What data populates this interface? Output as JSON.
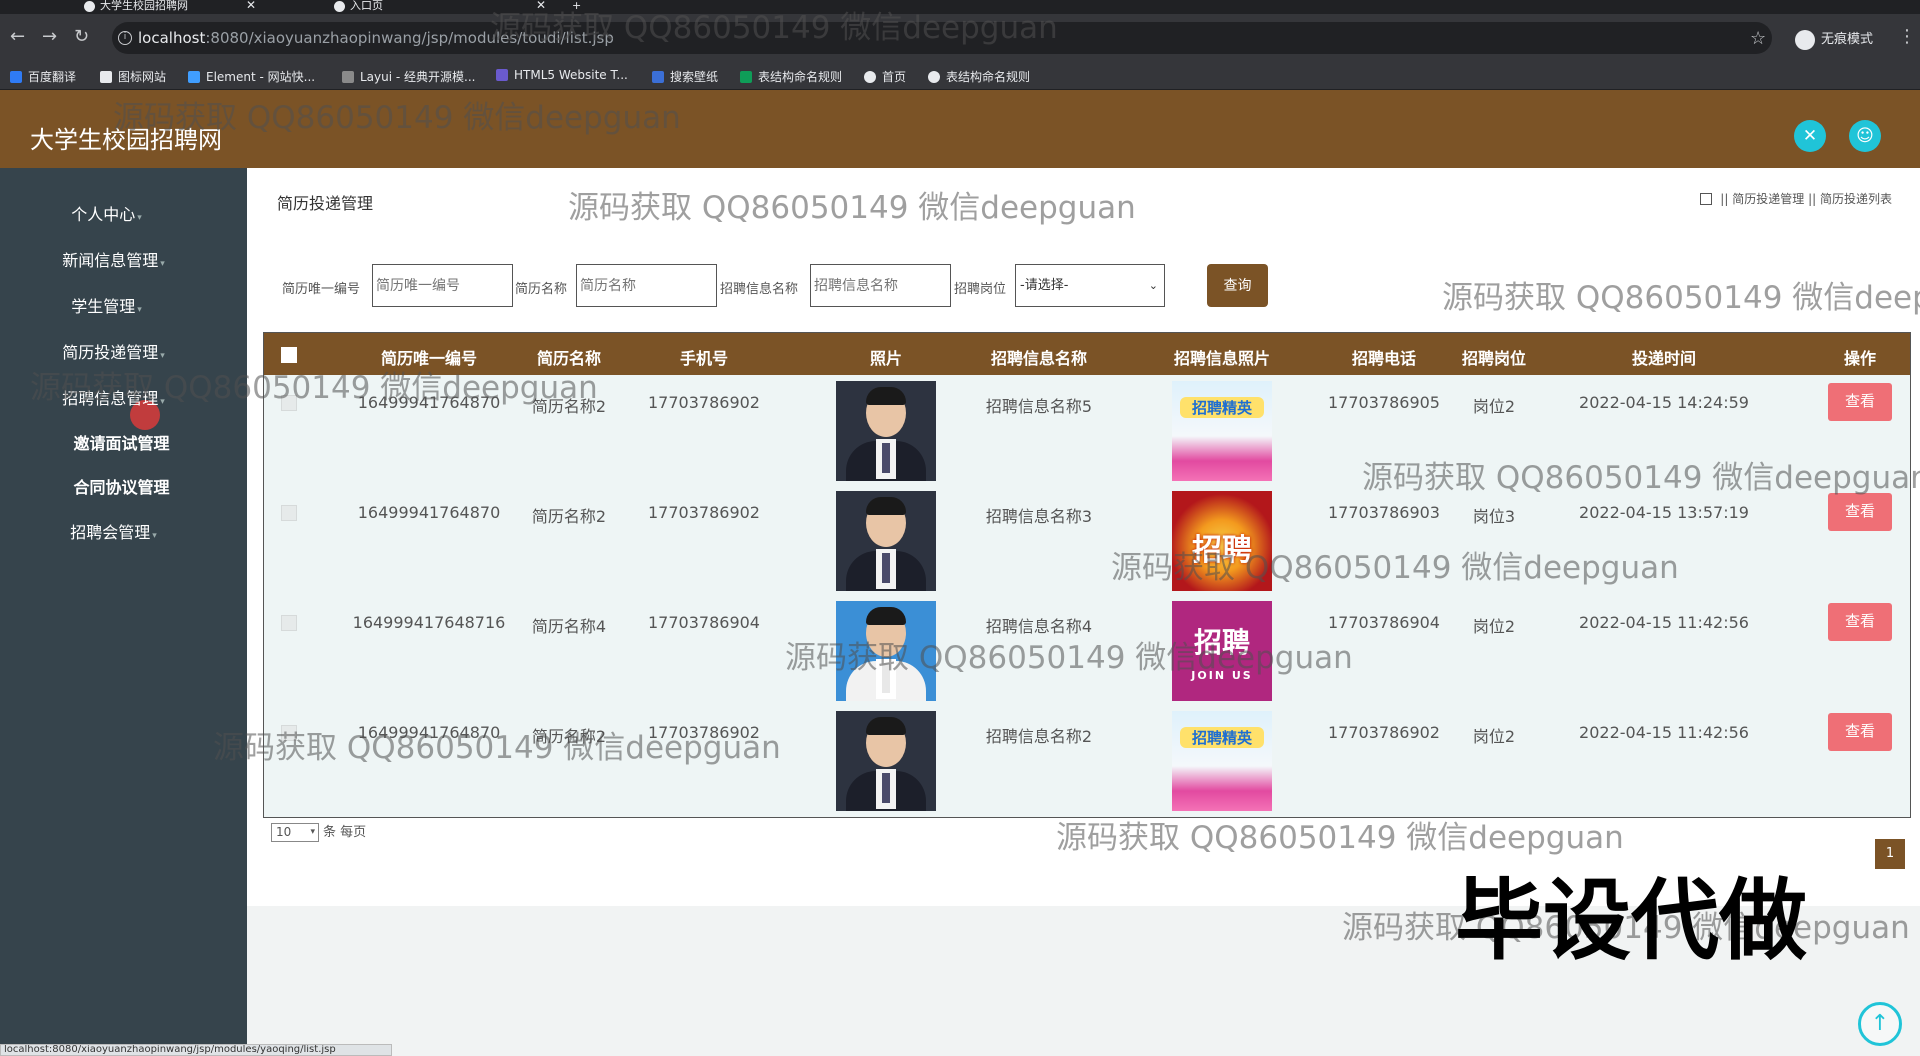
{
  "browser": {
    "tabs": [
      {
        "title": "大学生校园招聘网"
      },
      {
        "title": "入口页"
      }
    ],
    "new_tab": "+",
    "url_host": "localhost",
    "url_rest": ":8080/xiaoyuanzhaopinwang/jsp/modules/toudi/list.jsp",
    "incognito_label": "无痕模式",
    "bookmarks": [
      "百度翻译",
      "图标网站",
      "Element - 网站快...",
      "Layui - 经典开源模...",
      "HTML5 Website T...",
      "搜索壁纸",
      "表结构命名规则",
      "首页",
      "表结构命名规则"
    ],
    "status_url": "localhost:8080/xiaoyuanzhaopinwang/jsp/modules/yaoqing/list.jsp"
  },
  "header": {
    "brand": "大学生校园招聘网"
  },
  "sidebar": {
    "items": [
      {
        "label": "个人中心"
      },
      {
        "label": "新闻信息管理"
      },
      {
        "label": "学生管理"
      },
      {
        "label": "简历投递管理"
      },
      {
        "label": "招聘信息管理"
      },
      {
        "label": "邀请面试管理"
      },
      {
        "label": "合同协议管理"
      },
      {
        "label": "招聘会管理"
      }
    ]
  },
  "page": {
    "title": "简历投递管理",
    "breadcrumb": [
      "简历投递管理",
      "简历投递列表"
    ],
    "breadcrumb_sep": "||"
  },
  "filters": {
    "f1_label": "简历唯一编号",
    "f1_placeholder": "简历唯一编号",
    "f2_label": "简历名称",
    "f2_placeholder": "简历名称",
    "f3_label": "招聘信息名称",
    "f3_placeholder": "招聘信息名称",
    "f4_label": "招聘岗位",
    "f4_value": "-请选择-",
    "query_label": "查询"
  },
  "table": {
    "headers": [
      "简历唯一编号",
      "简历名称",
      "手机号",
      "照片",
      "招聘信息名称",
      "招聘信息照片",
      "招聘电话",
      "招聘岗位",
      "投递时间",
      "操作"
    ],
    "rows": [
      {
        "id": "16499941764870",
        "name": "简历名称2",
        "phone": "17703786902",
        "job": "招聘信息名称5",
        "job_phone": "17703786905",
        "position": "岗位2",
        "time": "2022-04-15 14:24:59",
        "action": "查看",
        "job_img_text": "招聘精英"
      },
      {
        "id": "16499941764870",
        "name": "简历名称2",
        "phone": "17703786902",
        "job": "招聘信息名称3",
        "job_phone": "17703786903",
        "position": "岗位3",
        "time": "2022-04-15 13:57:19",
        "action": "查看",
        "job_img_text": "招聘"
      },
      {
        "id": "164999417648716",
        "name": "简历名称4",
        "phone": "17703786904",
        "job": "招聘信息名称4",
        "job_phone": "17703786904",
        "position": "岗位2",
        "time": "2022-04-15 11:42:56",
        "action": "查看",
        "job_img_text": "招聘",
        "job_img_sub": "JOIN US"
      },
      {
        "id": "16499941764870",
        "name": "简历名称2",
        "phone": "17703786902",
        "job": "招聘信息名称2",
        "job_phone": "17703786902",
        "position": "岗位2",
        "time": "2022-04-15 11:42:56",
        "action": "查看",
        "job_img_text": "招聘精英"
      }
    ]
  },
  "pager": {
    "page_size": "10",
    "per_page_label": "条 每页",
    "current_page": "1"
  },
  "watermark": {
    "text": "源码获取 QQ86050149 微信deepguan",
    "big_text": "毕设代做"
  },
  "colors": {
    "brand": "#7b5326",
    "sidebar": "#36444c",
    "accent": "#20c4d8",
    "view_button": "#ef6f76"
  }
}
